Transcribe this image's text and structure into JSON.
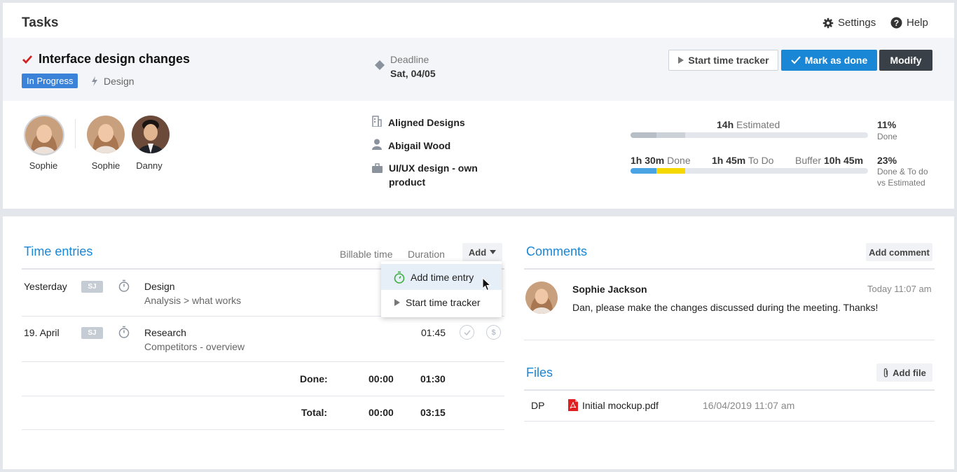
{
  "header": {
    "title": "Tasks",
    "settings_label": "Settings",
    "help_label": "Help"
  },
  "task": {
    "title": "Interface design changes",
    "status": "In Progress",
    "category": "Design",
    "deadline_label": "Deadline",
    "deadline_value": "Sat, 04/05",
    "actions": {
      "start_tracker": "Start time tracker",
      "mark_done": "Mark as done",
      "modify": "Modify"
    }
  },
  "people": {
    "owner": {
      "name": "Sophie"
    },
    "assignees": [
      {
        "name": "Sophie"
      },
      {
        "name": "Danny"
      }
    ]
  },
  "info": {
    "client": "Aligned Designs",
    "contact": "Abigail Wood",
    "project_line1": "UI/UX design - own",
    "project_line2": "product"
  },
  "stats": {
    "estimated_value": "14h",
    "estimated_label": "Estimated",
    "done_value": "1h 30m",
    "done_label": "Done",
    "todo_value": "1h 45m",
    "todo_label": "To Do",
    "buffer_label": "Buffer",
    "buffer_value": "10h 45m",
    "pct_done": "11%",
    "pct_done_label": "Done",
    "pct_total": "23%",
    "pct_total_label_1": "Done & To do",
    "pct_total_label_2": "vs Estimated",
    "bar1_done_fraction": 0.11,
    "bar1_todo_fraction": 0.12,
    "bar2_done_fraction": 0.11,
    "bar2_todo_fraction": 0.12,
    "colors": {
      "done": "#4aa3e3",
      "todo": "#f5d800",
      "estimated": "#c7ccd2"
    }
  },
  "time_entries": {
    "title": "Time entries",
    "col_billable": "Billable time",
    "col_duration": "Duration",
    "add_label": "Add",
    "dropdown": {
      "add_entry": "Add time entry",
      "start_tracker": "Start time tracker"
    },
    "rows": [
      {
        "date": "Yesterday",
        "initials": "SJ",
        "title": "Design",
        "subtitle": "Analysis > what works",
        "duration": ""
      },
      {
        "date": "19. April",
        "initials": "SJ",
        "title": "Research",
        "subtitle": "Competitors - overview",
        "duration": "01:45"
      }
    ],
    "done_label": "Done:",
    "done_billable": "00:00",
    "done_duration": "01:30",
    "total_label": "Total:",
    "total_billable": "00:00",
    "total_duration": "03:15"
  },
  "comments": {
    "title": "Comments",
    "add_label": "Add comment",
    "items": [
      {
        "author": "Sophie Jackson",
        "time": "Today 11:07 am",
        "text": "Dan, please make the changes discussed during the meeting. Thanks!"
      }
    ]
  },
  "files": {
    "title": "Files",
    "add_label": "Add file",
    "items": [
      {
        "initials": "DP",
        "name": "Initial mockup.pdf",
        "date": "16/04/2019 11:07 am"
      }
    ]
  }
}
